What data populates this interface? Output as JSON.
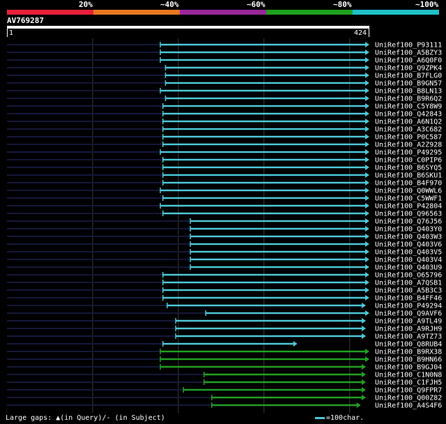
{
  "identity_scale": {
    "labels": [
      "20%",
      "~40%",
      "~60%",
      "~80%",
      "~100%"
    ],
    "colors": [
      "#e8203a",
      "#e87820",
      "#9a289a",
      "#20a020",
      "#20c0c8"
    ]
  },
  "query": {
    "name": "AV769287",
    "start": "1",
    "end": "424",
    "length": 424
  },
  "hits": [
    {
      "label": "UniRef100_P93111",
      "start": 180,
      "end": 424,
      "tier": "~100%"
    },
    {
      "label": "UniRef100_A5BZY3",
      "start": 180,
      "end": 424,
      "tier": "~100%"
    },
    {
      "label": "UniRef100_A6Q0F0",
      "start": 180,
      "end": 424,
      "tier": "~100%"
    },
    {
      "label": "UniRef100_Q9ZPK4",
      "start": 186,
      "end": 424,
      "tier": "~100%"
    },
    {
      "label": "UniRef100_B7FLG0",
      "start": 186,
      "end": 424,
      "tier": "~100%"
    },
    {
      "label": "UniRef100_B9GN57",
      "start": 186,
      "end": 424,
      "tier": "~100%"
    },
    {
      "label": "UniRef100_B8LN13",
      "start": 180,
      "end": 424,
      "tier": "~100%"
    },
    {
      "label": "UniRef100_B9R6Q2",
      "start": 186,
      "end": 424,
      "tier": "~100%"
    },
    {
      "label": "UniRef100_C5Y8W9",
      "start": 183,
      "end": 424,
      "tier": "~100%"
    },
    {
      "label": "UniRef100_Q42843",
      "start": 183,
      "end": 424,
      "tier": "~100%"
    },
    {
      "label": "UniRef100_A6N1Q2",
      "start": 183,
      "end": 424,
      "tier": "~100%"
    },
    {
      "label": "UniRef100_A3C682",
      "start": 183,
      "end": 424,
      "tier": "~100%"
    },
    {
      "label": "UniRef100_P0C587",
      "start": 183,
      "end": 424,
      "tier": "~100%"
    },
    {
      "label": "UniRef100_A2Z928",
      "start": 183,
      "end": 424,
      "tier": "~100%"
    },
    {
      "label": "UniRef100_P49295",
      "start": 180,
      "end": 424,
      "tier": "~100%"
    },
    {
      "label": "UniRef100_C0PIP6",
      "start": 183,
      "end": 424,
      "tier": "~100%"
    },
    {
      "label": "UniRef100_B6SYQ5",
      "start": 183,
      "end": 424,
      "tier": "~100%"
    },
    {
      "label": "UniRef100_B6SKU1",
      "start": 183,
      "end": 424,
      "tier": "~100%"
    },
    {
      "label": "UniRef100_B4F970",
      "start": 183,
      "end": 424,
      "tier": "~100%"
    },
    {
      "label": "UniRef100_Q0WWL6",
      "start": 180,
      "end": 424,
      "tier": "~100%"
    },
    {
      "label": "UniRef100_C5WWF1",
      "start": 183,
      "end": 424,
      "tier": "~100%"
    },
    {
      "label": "UniRef100_P42804",
      "start": 180,
      "end": 424,
      "tier": "~100%"
    },
    {
      "label": "UniRef100_Q96563",
      "start": 183,
      "end": 424,
      "tier": "~100%"
    },
    {
      "label": "UniRef100_Q76J56",
      "start": 215,
      "end": 424,
      "tier": "~100%"
    },
    {
      "label": "UniRef100_Q403Y0",
      "start": 215,
      "end": 424,
      "tier": "~100%"
    },
    {
      "label": "UniRef100_Q403W3",
      "start": 215,
      "end": 424,
      "tier": "~100%"
    },
    {
      "label": "UniRef100_Q403V6",
      "start": 215,
      "end": 424,
      "tier": "~100%"
    },
    {
      "label": "UniRef100_Q403V5",
      "start": 215,
      "end": 424,
      "tier": "~100%"
    },
    {
      "label": "UniRef100_Q403V4",
      "start": 215,
      "end": 424,
      "tier": "~100%"
    },
    {
      "label": "UniRef100_Q403U9",
      "start": 215,
      "end": 424,
      "tier": "~100%"
    },
    {
      "label": "UniRef100_O65796",
      "start": 183,
      "end": 424,
      "tier": "~100%"
    },
    {
      "label": "UniRef100_A7QSB1",
      "start": 183,
      "end": 424,
      "tier": "~100%"
    },
    {
      "label": "UniRef100_A5B3C3",
      "start": 183,
      "end": 424,
      "tier": "~100%"
    },
    {
      "label": "UniRef100_B4FF46",
      "start": 183,
      "end": 424,
      "tier": "~100%"
    },
    {
      "label": "UniRef100_P49294",
      "start": 188,
      "end": 420,
      "tier": "~100%"
    },
    {
      "label": "UniRef100_Q9AVF6",
      "start": 233,
      "end": 424,
      "tier": "~100%"
    },
    {
      "label": "UniRef100_A9TL49",
      "start": 198,
      "end": 420,
      "tier": "~100%"
    },
    {
      "label": "UniRef100_A9RJH9",
      "start": 198,
      "end": 420,
      "tier": "~100%"
    },
    {
      "label": "UniRef100_A9TZ73",
      "start": 198,
      "end": 420,
      "tier": "~100%"
    },
    {
      "label": "UniRef100_Q8RUB4",
      "start": 183,
      "end": 340,
      "tier": "~100%"
    },
    {
      "label": "UniRef100_B9RX38",
      "start": 180,
      "end": 424,
      "tier": "~80%"
    },
    {
      "label": "UniRef100_B9HN66",
      "start": 180,
      "end": 424,
      "tier": "~80%"
    },
    {
      "label": "UniRef100_B9GJ04",
      "start": 180,
      "end": 420,
      "tier": "~80%"
    },
    {
      "label": "UniRef100_C1N0N8",
      "start": 231,
      "end": 420,
      "tier": "~80%"
    },
    {
      "label": "UniRef100_C1FJH5",
      "start": 231,
      "end": 420,
      "tier": "~80%"
    },
    {
      "label": "UniRef100_Q9FPR7",
      "start": 207,
      "end": 420,
      "tier": "~80%"
    },
    {
      "label": "UniRef100_Q00Z82",
      "start": 240,
      "end": 420,
      "tier": "~80%"
    },
    {
      "label": "UniRef100_A4S4F6",
      "start": 240,
      "end": 414,
      "tier": "~80%"
    }
  ],
  "legend": {
    "gaps_text": "Large gaps: ▲(in Query)/- (in Subject)",
    "scale_text": "=100char."
  }
}
